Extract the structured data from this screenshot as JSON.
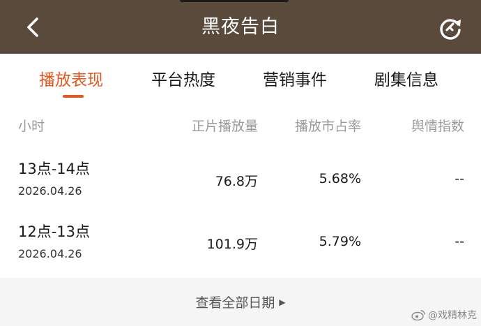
{
  "header": {
    "title": "黑夜告白",
    "back_icon": "chevron-left-icon",
    "refresh_icon": "refresh-icon",
    "background": "#5a4a3c"
  },
  "tabs": [
    {
      "label": "播放表现",
      "active": true
    },
    {
      "label": "平台热度",
      "active": false
    },
    {
      "label": "营销事件",
      "active": false
    },
    {
      "label": "剧集信息",
      "active": false
    }
  ],
  "accent_color": "#e2581f",
  "table": {
    "columns": [
      "小时",
      "正片播放量",
      "播放市占率",
      "舆情指数"
    ],
    "rows": [
      {
        "hour": "13点-14点",
        "date": "2026.04.26",
        "plays": "76.8万",
        "share": "5.68%",
        "sentiment": "--"
      },
      {
        "hour": "12点-13点",
        "date": "2026.04.26",
        "plays": "101.9万",
        "share": "5.79%",
        "sentiment": "--"
      }
    ]
  },
  "footer": {
    "view_all_label": "查看全部日期",
    "arrow_icon": "triangle-right-icon"
  },
  "watermark": {
    "text": "@戏精林克",
    "icon": "weibo-icon"
  }
}
